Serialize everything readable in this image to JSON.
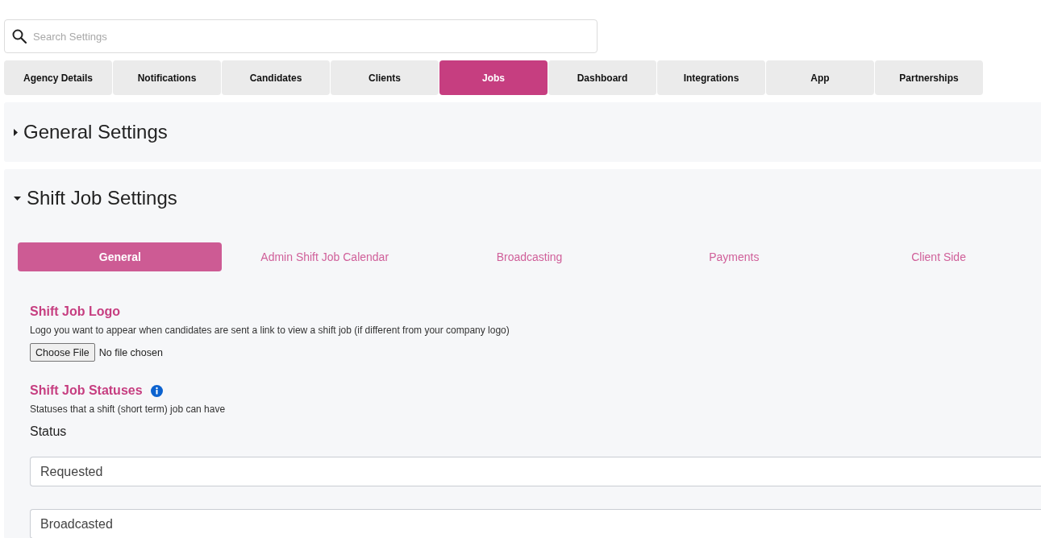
{
  "search": {
    "placeholder": "Search Settings"
  },
  "tabs": [
    {
      "label": "Agency Details",
      "selected": false
    },
    {
      "label": "Notifications",
      "selected": false
    },
    {
      "label": "Candidates",
      "selected": false
    },
    {
      "label": "Clients",
      "selected": false
    },
    {
      "label": "Jobs",
      "selected": true
    },
    {
      "label": "Dashboard",
      "selected": false
    },
    {
      "label": "Integrations",
      "selected": false
    },
    {
      "label": "App",
      "selected": false
    },
    {
      "label": "Partnerships",
      "selected": false
    }
  ],
  "sections": [
    {
      "title": "General Settings",
      "expanded": false
    },
    {
      "title": "Shift Job Settings",
      "expanded": true,
      "subtabs": [
        {
          "label": "General",
          "selected": true
        },
        {
          "label": "Admin Shift Job Calendar",
          "selected": false
        },
        {
          "label": "Broadcasting",
          "selected": false
        },
        {
          "label": "Payments",
          "selected": false
        },
        {
          "label": "Client Side",
          "selected": false
        }
      ],
      "logo": {
        "title": "Shift Job Logo",
        "description": "Logo you want to appear when candidates are sent a link to view a shift job (if different from your company logo)",
        "file_button": "Choose File",
        "file_status": "No file chosen"
      },
      "statuses": {
        "title": "Shift Job Statuses",
        "description": "Statuses that a shift (short term) job can have",
        "field_label": "Status",
        "items": [
          "Requested",
          "Broadcasted"
        ]
      }
    }
  ]
}
